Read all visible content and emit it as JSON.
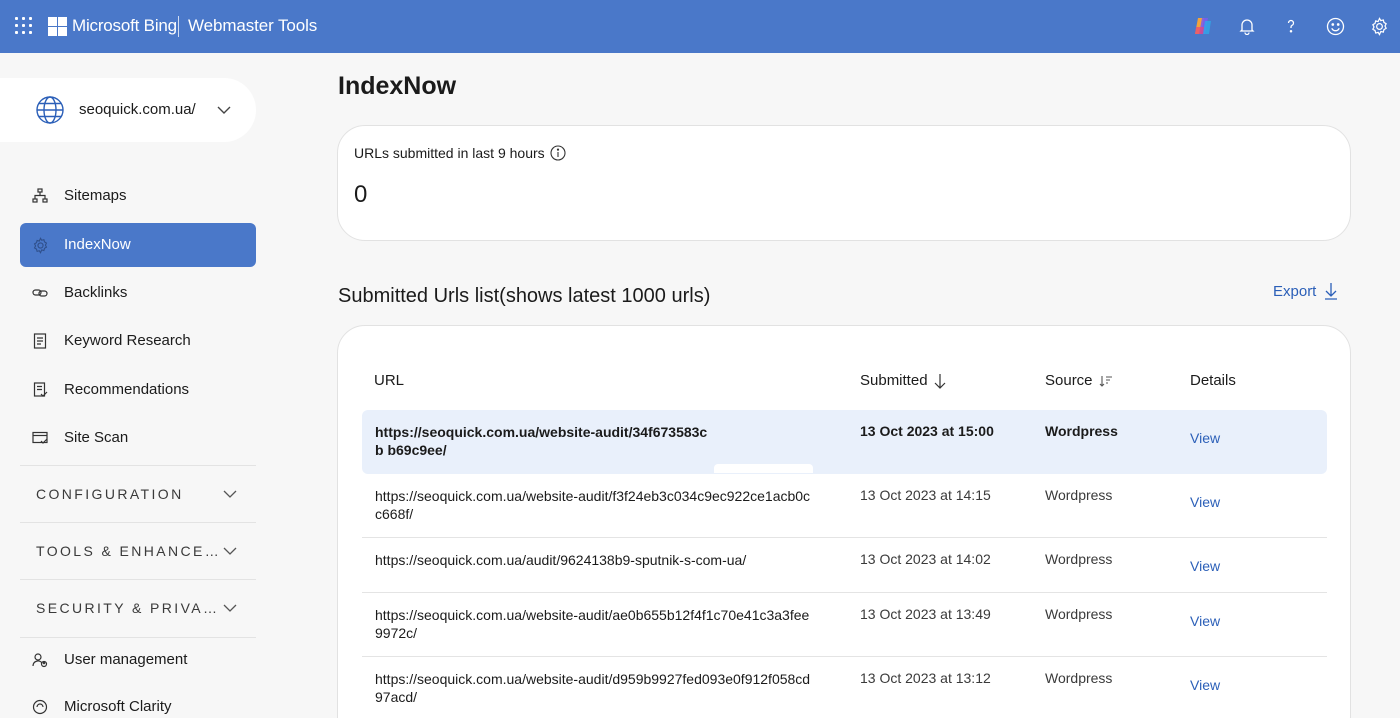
{
  "header": {
    "brand": "Microsoft Bing",
    "product": "Webmaster Tools",
    "icons": [
      "apps-waffle-icon",
      "copilot-icon",
      "notifications-bell-icon",
      "help-icon",
      "feedback-smiley-icon",
      "settings-gear-icon"
    ]
  },
  "colors": {
    "header_bg": "#4a78c9",
    "active_nav_bg": "#4a78c9",
    "link": "#2b5fb8",
    "selected_row_bg": "#e9f0fb"
  },
  "sidebar": {
    "site": "seoquick.com.ua/",
    "items": [
      {
        "label": "Sitemaps",
        "icon": "sitemap-icon"
      },
      {
        "label": "IndexNow",
        "icon": "gear-icon",
        "active": true
      },
      {
        "label": "Backlinks",
        "icon": "link-icon"
      },
      {
        "label": "Keyword Research",
        "icon": "document-icon"
      },
      {
        "label": "Recommendations",
        "icon": "checklist-icon"
      },
      {
        "label": "Site Scan",
        "icon": "scan-icon"
      }
    ],
    "groups": [
      {
        "label": "CONFIGURATION"
      },
      {
        "label": "TOOLS & ENHANCE…"
      },
      {
        "label": "SECURITY & PRIVA…"
      }
    ],
    "bottom_items": [
      {
        "label": "User management",
        "icon": "user-management-icon"
      },
      {
        "label": "Microsoft Clarity",
        "icon": "clarity-icon"
      }
    ]
  },
  "main": {
    "title": "IndexNow",
    "stat": {
      "label": "URLs submitted in last 9 hours",
      "value": "0"
    },
    "list_title": "Submitted Urls list(shows latest 1000 urls)",
    "export_label": "Export",
    "table": {
      "headers": {
        "url": "URL",
        "submitted": "Submitted",
        "source": "Source",
        "details": "Details"
      },
      "rows": [
        {
          "url": "https://seoquick.com.ua/website-audit/34f673583cb b69c9ee/",
          "submitted": "13 Oct 2023 at 15:00",
          "source": "Wordpress",
          "details": "View"
        },
        {
          "url": "https://seoquick.com.ua/website-audit/f3f24eb3c034c9ec922ce1acb0c c668f/",
          "submitted": "13 Oct 2023 at 14:15",
          "source": "Wordpress",
          "details": "View"
        },
        {
          "url": "https://seoquick.com.ua/audit/9624138b9-sputnik-s-com-ua/",
          "submitted": "13 Oct 2023 at 14:02",
          "source": "Wordpress",
          "details": "View"
        },
        {
          "url": "https://seoquick.com.ua/website-audit/ae0b655b12f4f1c70e41c3a3fee 9972c/",
          "submitted": "13 Oct 2023 at 13:49",
          "source": "Wordpress",
          "details": "View"
        },
        {
          "url": "https://seoquick.com.ua/website-audit/d959b9927fed093e0f912f058cd 97acd/",
          "submitted": "13 Oct 2023 at 13:12",
          "source": "Wordpress",
          "details": "View"
        }
      ]
    }
  }
}
